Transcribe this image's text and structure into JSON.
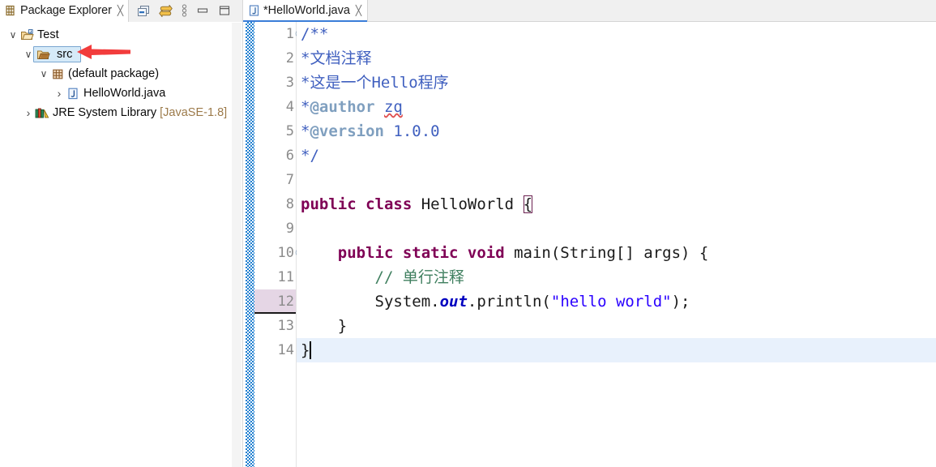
{
  "explorer": {
    "tab": {
      "label": "Package Explorer",
      "icon": "package-explorer-icon",
      "close": "╳"
    },
    "toolbar": [
      {
        "name": "collapse-all-icon",
        "tooltip": "Collapse All"
      },
      {
        "name": "link-with-editor-icon",
        "tooltip": "Link with Editor"
      },
      {
        "name": "view-menu-icon",
        "tooltip": "View Menu"
      },
      {
        "name": "minimize-icon",
        "tooltip": "Minimize"
      },
      {
        "name": "maximize-icon",
        "tooltip": "Maximize"
      }
    ],
    "tree": [
      {
        "label": "Test",
        "icon": "java-project-icon",
        "twisty": "∨",
        "indent": 0,
        "selected": false,
        "suffix": ""
      },
      {
        "label": "src",
        "icon": "source-folder-icon",
        "twisty": "∨",
        "indent": 1,
        "selected": true,
        "suffix": ""
      },
      {
        "label": "(default package)",
        "icon": "package-icon",
        "twisty": "∨",
        "indent": 2,
        "selected": false,
        "suffix": ""
      },
      {
        "label": "HelloWorld.java",
        "icon": "java-file-icon",
        "twisty": "›",
        "indent": 3,
        "selected": false,
        "suffix": ""
      },
      {
        "label": "JRE System Library",
        "icon": "jre-library-icon",
        "twisty": "›",
        "indent": 1,
        "selected": false,
        "suffix": " [JavaSE-1.8]"
      }
    ],
    "annotation": {
      "name": "red-arrow-annotation",
      "color": "#f23c3c",
      "points_to": "src"
    }
  },
  "editor": {
    "tab": {
      "label": "*HelloWorld.java",
      "icon": "java-file-icon",
      "close": "╳",
      "dirty": true
    },
    "accent": "#3b7dd8",
    "current_line": 14,
    "changed_line": 12,
    "fold_lines": [
      1,
      10
    ],
    "lines": [
      {
        "n": 1,
        "fold": "collapse",
        "changed": false,
        "current": false,
        "tokens": [
          {
            "t": "/**",
            "c": "jdoc"
          }
        ]
      },
      {
        "n": 2,
        "fold": "",
        "changed": false,
        "current": false,
        "tokens": [
          {
            "t": "*文档注释",
            "c": "jdoc"
          }
        ]
      },
      {
        "n": 3,
        "fold": "",
        "changed": false,
        "current": false,
        "tokens": [
          {
            "t": "*这是一个Hello程序",
            "c": "jdoc"
          }
        ]
      },
      {
        "n": 4,
        "fold": "",
        "changed": false,
        "current": false,
        "tokens": [
          {
            "t": "*",
            "c": "jdoc"
          },
          {
            "t": "@author",
            "c": "jtag"
          },
          {
            "t": " ",
            "c": "jdoc"
          },
          {
            "t": "zq",
            "c": "jdoc spell"
          }
        ]
      },
      {
        "n": 5,
        "fold": "",
        "changed": false,
        "current": false,
        "tokens": [
          {
            "t": "*",
            "c": "jdoc"
          },
          {
            "t": "@version",
            "c": "jtag"
          },
          {
            "t": " 1.0.0",
            "c": "jdoc"
          }
        ]
      },
      {
        "n": 6,
        "fold": "",
        "changed": false,
        "current": false,
        "tokens": [
          {
            "t": "*/",
            "c": "jdoc"
          }
        ]
      },
      {
        "n": 7,
        "fold": "",
        "changed": false,
        "current": false,
        "tokens": []
      },
      {
        "n": 8,
        "fold": "",
        "changed": false,
        "current": false,
        "tokens": [
          {
            "t": "public class ",
            "c": "kw"
          },
          {
            "t": "HelloWorld ",
            "c": "plain"
          },
          {
            "t": "{",
            "c": "plain mtch"
          }
        ]
      },
      {
        "n": 9,
        "fold": "",
        "changed": false,
        "current": false,
        "tokens": []
      },
      {
        "n": 10,
        "fold": "collapse",
        "changed": false,
        "current": false,
        "tokens": [
          {
            "t": "    ",
            "c": "plain"
          },
          {
            "t": "public static void ",
            "c": "kw"
          },
          {
            "t": "main(String[] args) {",
            "c": "plain"
          }
        ]
      },
      {
        "n": 11,
        "fold": "",
        "changed": false,
        "current": false,
        "tokens": [
          {
            "t": "        // 单行注释",
            "c": "cmt"
          }
        ]
      },
      {
        "n": 12,
        "fold": "",
        "changed": true,
        "current": false,
        "tokens": [
          {
            "t": "        System.",
            "c": "plain"
          },
          {
            "t": "out",
            "c": "fld"
          },
          {
            "t": ".println(",
            "c": "plain"
          },
          {
            "t": "\"hello world\"",
            "c": "str"
          },
          {
            "t": ");",
            "c": "plain"
          }
        ]
      },
      {
        "n": 13,
        "fold": "",
        "changed": false,
        "current": false,
        "tokens": [
          {
            "t": "    }",
            "c": "plain"
          }
        ]
      },
      {
        "n": 14,
        "fold": "",
        "changed": false,
        "current": true,
        "tokens": [
          {
            "t": "}",
            "c": "plain"
          }
        ]
      }
    ]
  }
}
